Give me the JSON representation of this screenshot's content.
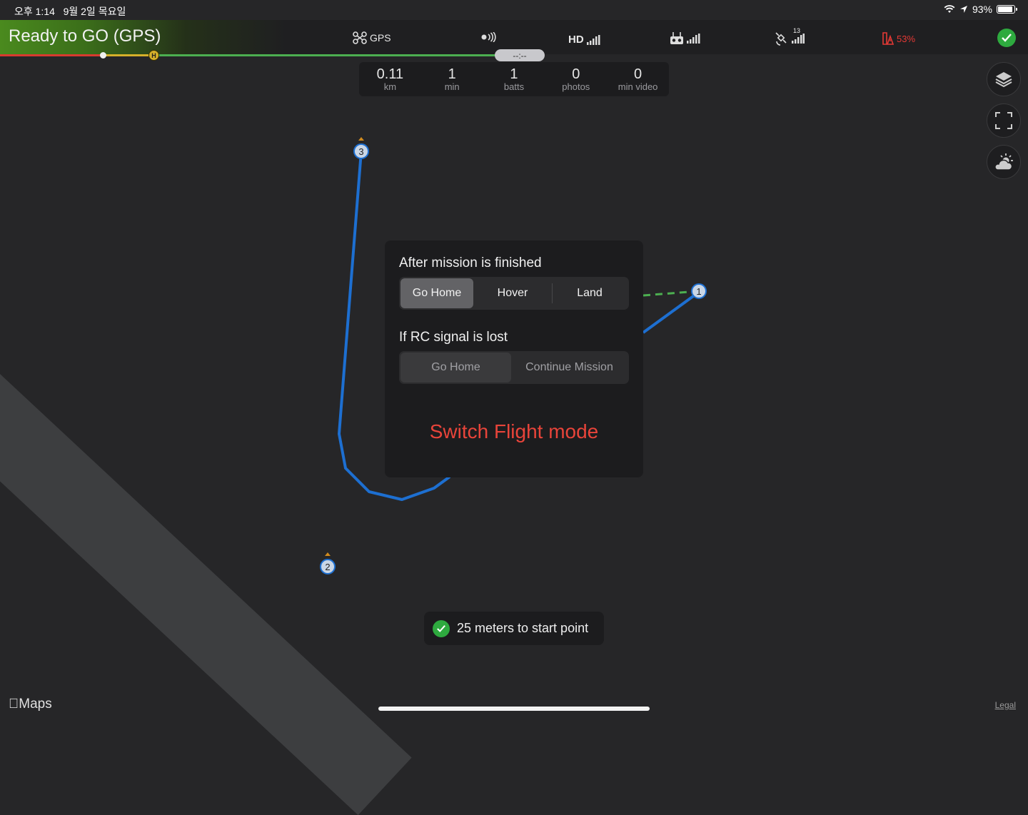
{
  "status_bar": {
    "time": "오후 1:14",
    "date": "9월 2일 목요일",
    "battery": "93%",
    "battery_level": 0.93
  },
  "telemetry": {
    "status": "Ready to GO (GPS)",
    "gps_label": "GPS",
    "hd_label": "HD",
    "satellites": "13",
    "battery_warning": "53%",
    "timer": "--:--"
  },
  "stats": [
    {
      "value": "0.11",
      "label": "km"
    },
    {
      "value": "1",
      "label": "min"
    },
    {
      "value": "1",
      "label": "batts"
    },
    {
      "value": "0",
      "label": "photos"
    },
    {
      "value": "0",
      "label": "min video"
    }
  ],
  "map": {
    "waypoints": [
      "1",
      "2",
      "3"
    ],
    "home_marker": "H",
    "route_color": "#1d6fd1",
    "home_line_color": "#4caf50"
  },
  "dialog": {
    "after_mission_label": "After mission is finished",
    "after_mission_options": [
      "Go Home",
      "Hover",
      "Land"
    ],
    "after_mission_selected": "Go Home",
    "rc_lost_label": "If RC signal is lost",
    "rc_lost_options": [
      "Go Home",
      "Continue Mission"
    ],
    "rc_lost_selected": "Go Home",
    "switch_mode": "Switch Flight mode"
  },
  "toast": {
    "text": "25 meters to start point"
  },
  "footer": {
    "maps_logo": "Maps",
    "legal": "Legal"
  },
  "colors": {
    "accent_green": "#2eaa3f",
    "danger": "#e8443a",
    "background": "#262628"
  }
}
